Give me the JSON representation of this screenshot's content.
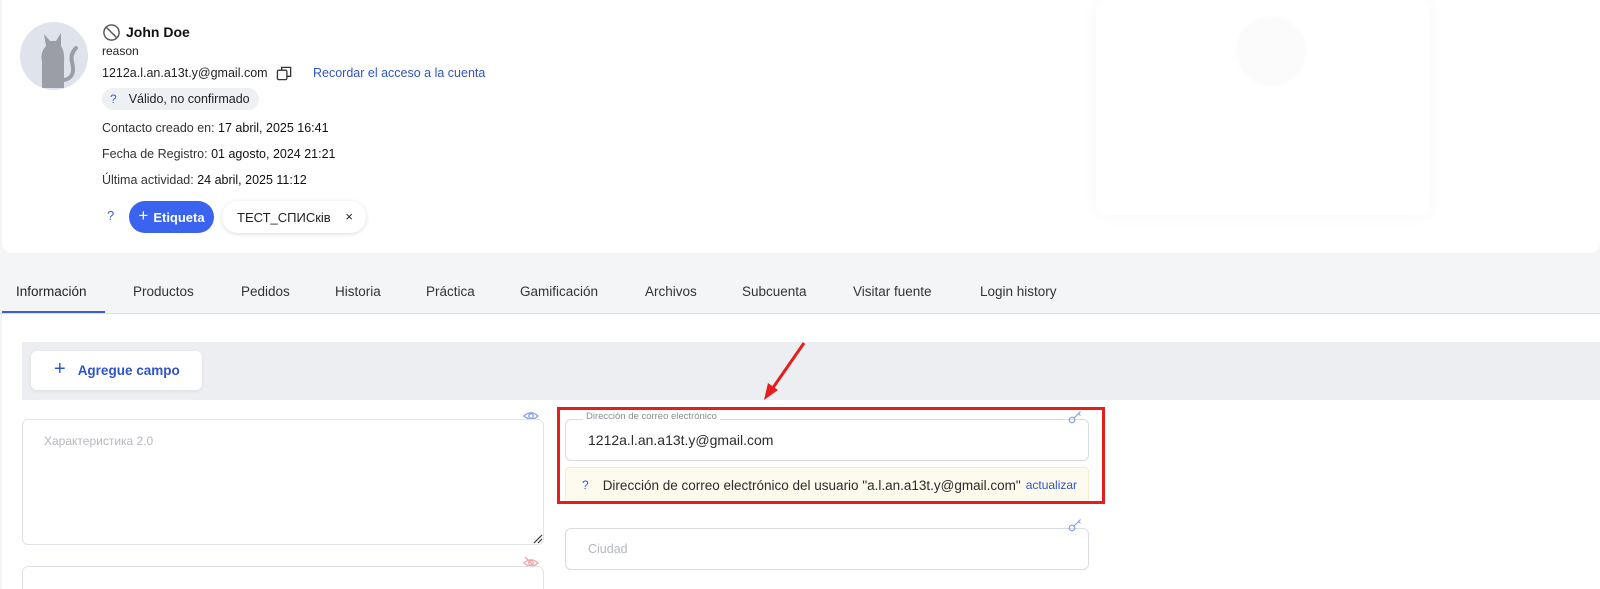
{
  "contact": {
    "name": "John Doe",
    "reason": "reason",
    "email": "1212a.l.an.a13t.y@gmail.com",
    "remind_link": "Recordar el acceso a la cuenta",
    "email_status": "Válido, no confirmado",
    "help_mark": "?",
    "meta": [
      {
        "label": "Contacto creado en: ",
        "value": "17 abril, 2025 16:41"
      },
      {
        "label": "Fecha de Registro: ",
        "value": "01 agosto, 2024 21:21"
      },
      {
        "label": "Última actividad: ",
        "value": "24 abril, 2025 11:12"
      }
    ],
    "add_tag_label": "Etiqueta",
    "tags": [
      "ТЕСТ_СПИСків"
    ]
  },
  "tabs": [
    "Información",
    "Productos",
    "Pedidos",
    "Historia",
    "Práctica",
    "Gamificación",
    "Archivos",
    "Subcuenta",
    "Visitar fuente",
    "Login history"
  ],
  "active_tab": "Información",
  "form": {
    "add_field_label": "Agregue campo",
    "textarea_placeholder": "Характеристика 2.0",
    "email_field_label": "Dirección de correo electrónico",
    "email_field_value": "1212a.l.an.a13t.y@gmail.com",
    "notice_text": "Dirección de correo electrónico del usuario \"a.l.an.a13t.y@gmail.com\"",
    "notice_link": "actualizar",
    "city_placeholder": "Ciudad"
  },
  "colors": {
    "primary": "#3a63f0",
    "link": "#2f54c9",
    "highlight": "#e51d1d",
    "notice_bg": "#fdfaee"
  },
  "icons": [
    "blocked-icon",
    "copy-icon",
    "eye-icon",
    "eye-off-icon",
    "key-icon",
    "plus-icon",
    "close-icon"
  ]
}
